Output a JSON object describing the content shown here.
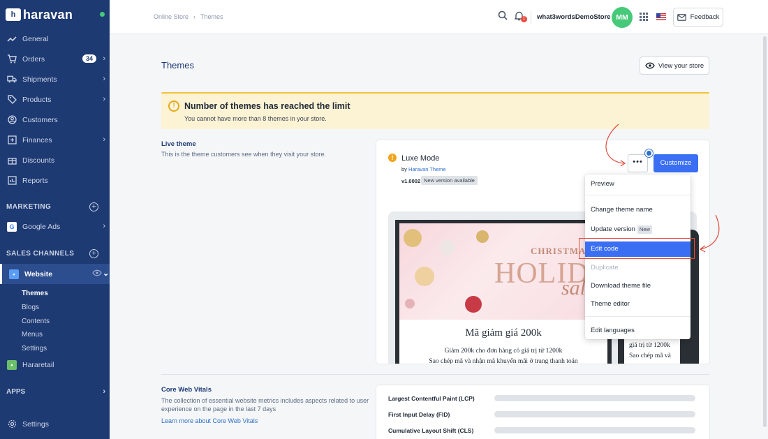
{
  "brand": {
    "name": "haravan",
    "logo_letter": "h"
  },
  "sidebar": {
    "items": [
      {
        "label": "General",
        "icon": "trend-icon"
      },
      {
        "label": "Orders",
        "icon": "cart-icon",
        "badge": "34"
      },
      {
        "label": "Shipments",
        "icon": "truck-icon"
      },
      {
        "label": "Products",
        "icon": "tag-icon"
      },
      {
        "label": "Customers",
        "icon": "user-icon"
      },
      {
        "label": "Finances",
        "icon": "finance-icon"
      },
      {
        "label": "Discounts",
        "icon": "gift-icon"
      },
      {
        "label": "Reports",
        "icon": "report-icon"
      }
    ],
    "marketing_title": "MARKETING",
    "google_ads": "Google Ads",
    "sales_channels_title": "SALES CHANNELS",
    "website": "Website",
    "website_sub": [
      "Themes",
      "Blogs",
      "Contents",
      "Menus",
      "Settings"
    ],
    "hararetail": "Hararetail",
    "apps_title": "APPS",
    "settings": "Settings"
  },
  "topbar": {
    "breadcrumb": [
      "Online Store",
      "Themes"
    ],
    "breadcrumb_sep": "›",
    "notification_count": "1",
    "store_name": "what3wordsDemoStore",
    "avatar_initials": "MM",
    "feedback": "Feedback"
  },
  "page": {
    "title": "Themes",
    "view_store": "View your store"
  },
  "warning": {
    "icon_glyph": "!",
    "title": "Number of themes has reached the limit",
    "text": "You cannot have more than 8 themes in your store."
  },
  "live_theme": {
    "title": "Live theme",
    "description": "This is the theme customers see when they visit your store.",
    "name": "Luxe Mode",
    "by_prefix": "by ",
    "author": "Haravan Theme",
    "version": "v1.0002",
    "version_tag": "New version available",
    "more_label": "•••",
    "customize": "Customize"
  },
  "preview": {
    "christmas": "CHRISTMAS",
    "holiday": "HOLIDA",
    "sale": "sale",
    "promo_title": "Mã giảm giá 200k",
    "promo_sub": "Giảm 200k cho đơn hàng có giá trị từ 1200k",
    "promo_sub2": "Sao chép mã và nhận mã khuyến mãi ở trang thanh toán",
    "mobile_text1": "giá trị từ 1200k",
    "mobile_text2": "Sao chép mã và"
  },
  "menu": {
    "preview": "Preview",
    "change_name": "Change theme name",
    "update_version": "Update version",
    "new_tag": "New",
    "edit_code": "Edit code",
    "duplicate": "Duplicate",
    "download": "Download theme file",
    "theme_editor": "Theme editor",
    "edit_languages": "Edit languages"
  },
  "core_web_vitals": {
    "title": "Core Web Vitals",
    "description": "The collection of essential website metrics includes aspects related to user experience on the page in the last 7 days",
    "link": "Learn more about Core Web Vitals",
    "metrics": [
      "Largest Contentful Paint (LCP)",
      "First Input Delay (FID)",
      "Cumulative Layout Shift (CLS)"
    ]
  },
  "colors": {
    "sidebar": "#1e3a73",
    "accent": "#3a6ff4",
    "warning": "#f0c23b",
    "annotation": "#e24a3a"
  }
}
